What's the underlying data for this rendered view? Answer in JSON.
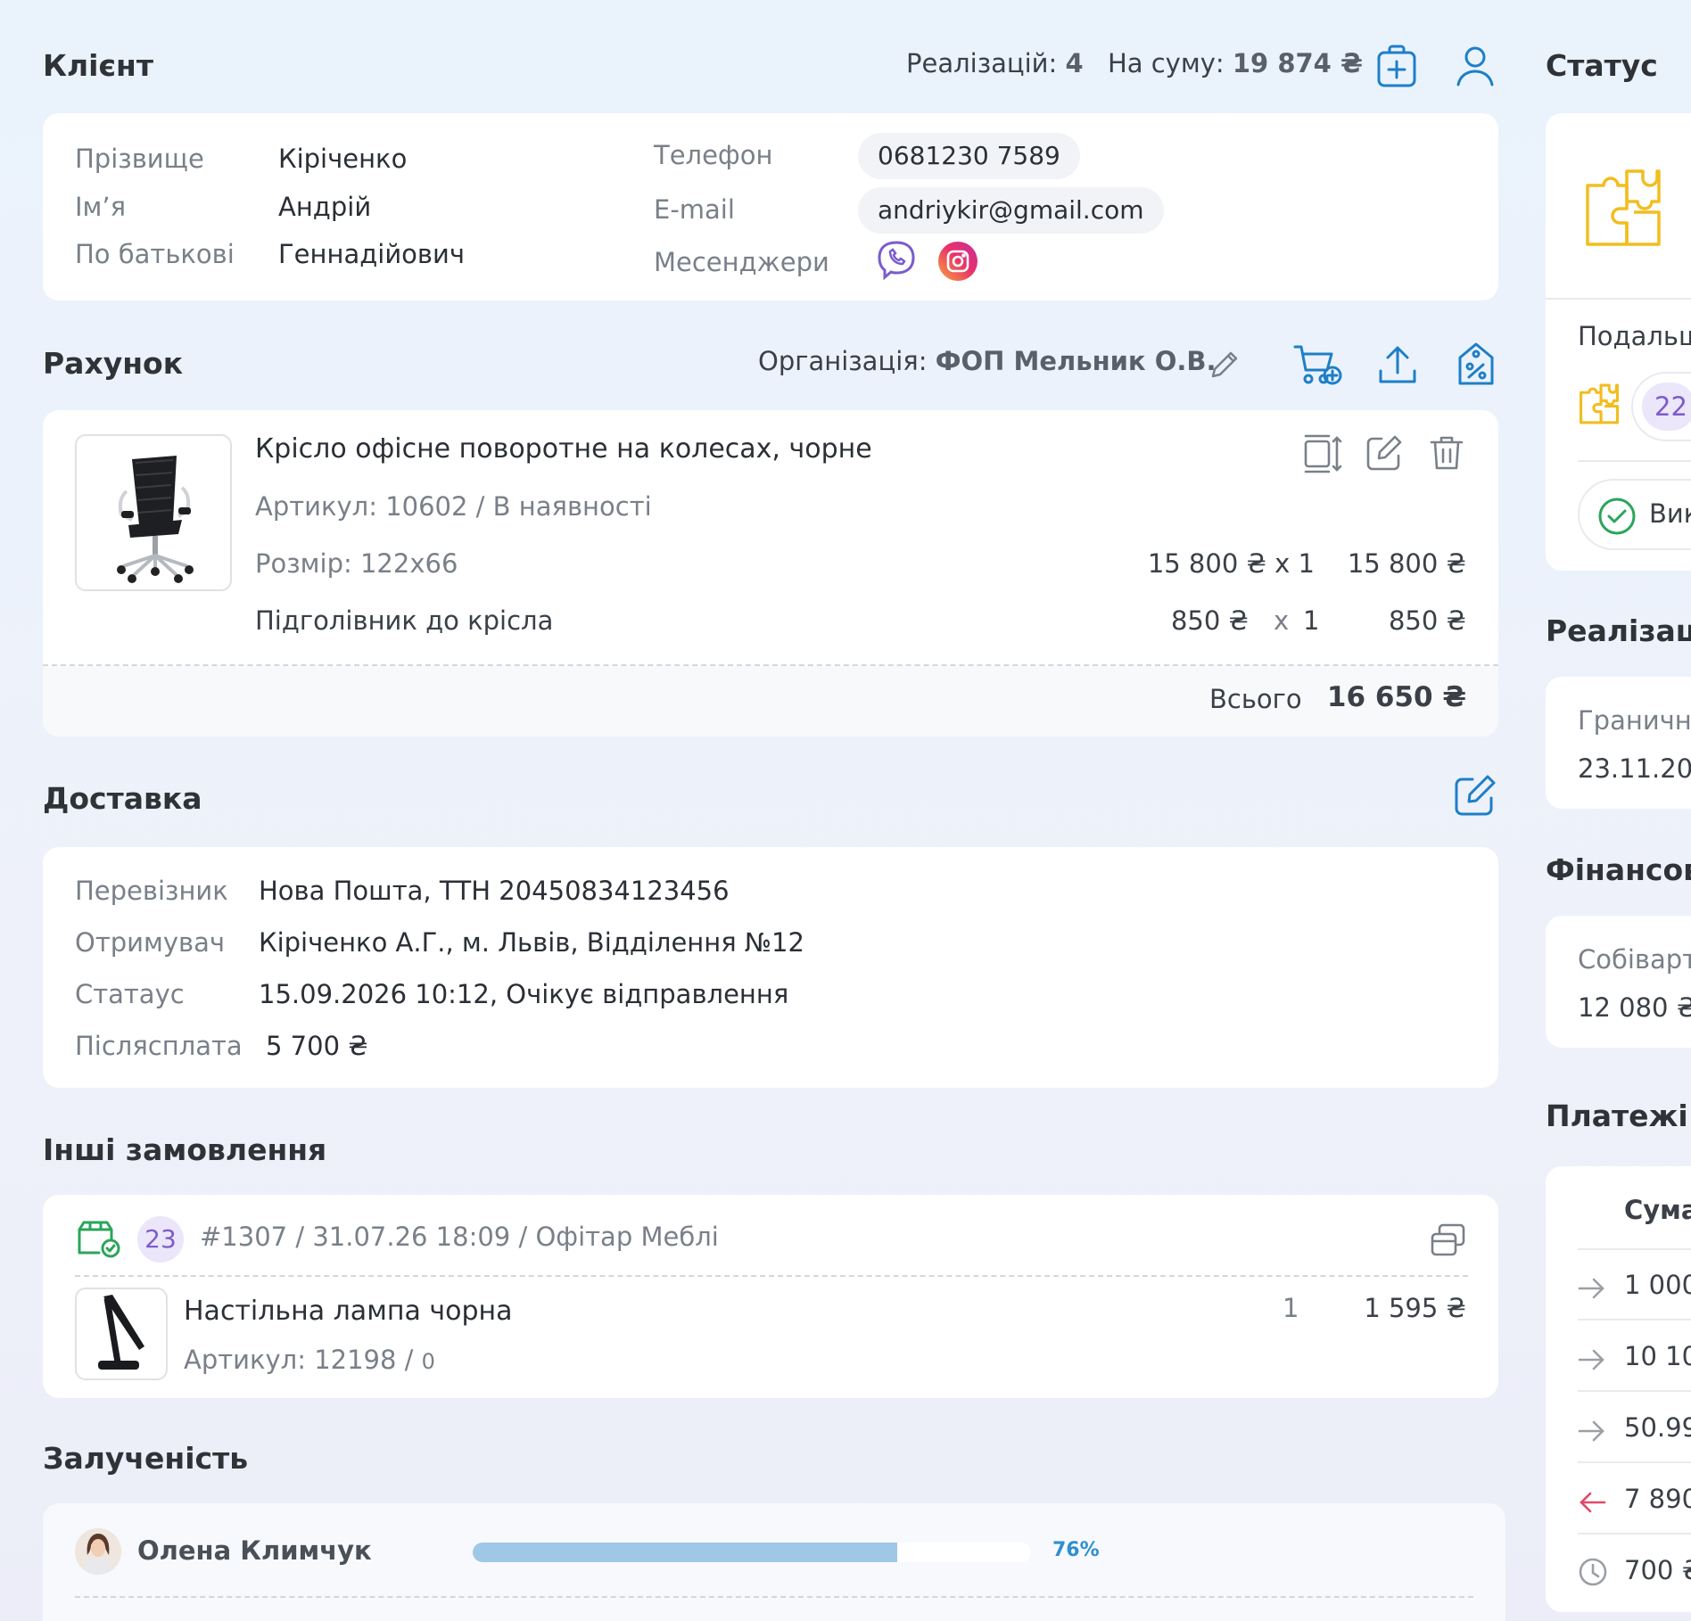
{
  "client": {
    "title": "Клієнт",
    "sales_label": "Реалізацій:",
    "sales_count": "4",
    "sum_label": "На суму:",
    "sum_value": "19 874 ₴",
    "fields": {
      "surname_label": "Прізвище",
      "surname": "Кіріченко",
      "name_label": "Ім’я",
      "name": "Андрій",
      "patronymic_label": "По батькові",
      "patronymic": "Геннадійович",
      "phone_label": "Телефон",
      "phone": "0681230 7589",
      "email_label": "E-mail",
      "email": "andriykir@gmail.com",
      "messengers_label": "Месенджери"
    }
  },
  "invoice": {
    "title": "Рахунок",
    "org_label": "Організація:",
    "org_value": "ФОП Мельник О.В.",
    "item": {
      "name": "Крісло офісне поворотне на колесах,  чорне",
      "sku_label": "Артикул: 10602",
      "availability": "/ В наявності",
      "size_label": "Розмір:",
      "size_value": "122х66",
      "unit_price": "15 800 ₴ х 1",
      "total": "15 800 ₴",
      "addon_name": "Підголівник до крісла",
      "addon_price": "850 ₴",
      "addon_x": "х",
      "addon_qty": "1",
      "addon_total": "850 ₴"
    },
    "total_label": "Всього",
    "total_value": "16 650 ₴"
  },
  "delivery": {
    "title": "Доставка",
    "carrier_label": "Перевізник",
    "carrier": "Нова Пошта, ТТН 20450834123456",
    "recipient_label": "Отримувач",
    "recipient": "Кіріченко А.Г., м. Львів, Відділення №12",
    "status_label": "Статаус",
    "status": "15.09.2026 10:12, Очікує відправлення",
    "cod_label": "Післясплата",
    "cod": "5 700 ₴"
  },
  "other_orders": {
    "title": "Інші замовлення",
    "badge": "23",
    "order_id": "#1307",
    "sep1": "/",
    "date": "31.07.26 18:09",
    "sep2": "/",
    "shop": "Офітар Меблі",
    "item_name": "Настільна лампа чорна",
    "item_sku": "Артикул: 12198",
    "item_sku_sep": "/",
    "item_stock": "0",
    "item_qty": "1",
    "item_price": "1 595 ₴"
  },
  "engagement": {
    "title": "Залученість",
    "person": "Олена Климчук",
    "percent_label": "76%",
    "percent": 0.76
  },
  "right": {
    "status_title": "Статус",
    "next_label": "Подальш",
    "badge": "22",
    "done_label": "Вик",
    "sales_title": "Реалізаці",
    "deadline_label": "Граничн",
    "deadline_value": "23.11.20",
    "finance_title": "Фінансов",
    "cost_label": "Собіварт",
    "cost_value": "12 080 ₴",
    "payments_title": "Платежі",
    "sum_col": "Сума",
    "payments": [
      "1 000",
      "10 10",
      "50.99",
      "7 890",
      "700 ₴"
    ]
  },
  "colors": {
    "accent": "#1d7fc7",
    "purple": "#7b5ccc",
    "green": "#2aa55a",
    "yellow": "#f2bd1f",
    "red": "#e04a6a",
    "progress": "#9fc8e6"
  }
}
